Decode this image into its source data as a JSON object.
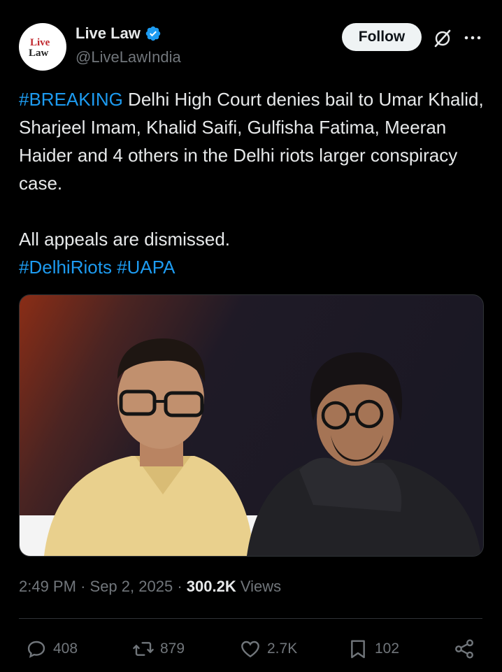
{
  "account": {
    "display_name": "Live Law",
    "handle": "@LiveLawIndia",
    "avatar_text_1": "Live",
    "avatar_text_2": "Law",
    "verified": true
  },
  "header": {
    "follow_label": "Follow",
    "icons": [
      "grok-icon",
      "more-icon"
    ]
  },
  "tweet": {
    "breaking_tag": "#BREAKING",
    "text_1": " Delhi High Court denies bail to Umar Khalid, Sharjeel Imam, Khalid Saifi, Gulfisha Fatima, Meeran Haider and 4 others in the Delhi riots larger conspiracy case.",
    "text_2": "All appeals are dismissed.",
    "hashtag_1": "#DelhiRiots",
    "hashtag_2": "#UAPA"
  },
  "meta": {
    "time": "2:49 PM",
    "separator": "·",
    "date": "Sep 2, 2025",
    "views_count": "300.2K",
    "views_label": "Views"
  },
  "actions": {
    "replies": "408",
    "reposts": "879",
    "likes": "2.7K",
    "bookmarks": "102"
  },
  "colors": {
    "background": "#000000",
    "text": "#e7e9ea",
    "muted": "#71767b",
    "link": "#1d9bf0",
    "verified": "#1d9bf0"
  }
}
